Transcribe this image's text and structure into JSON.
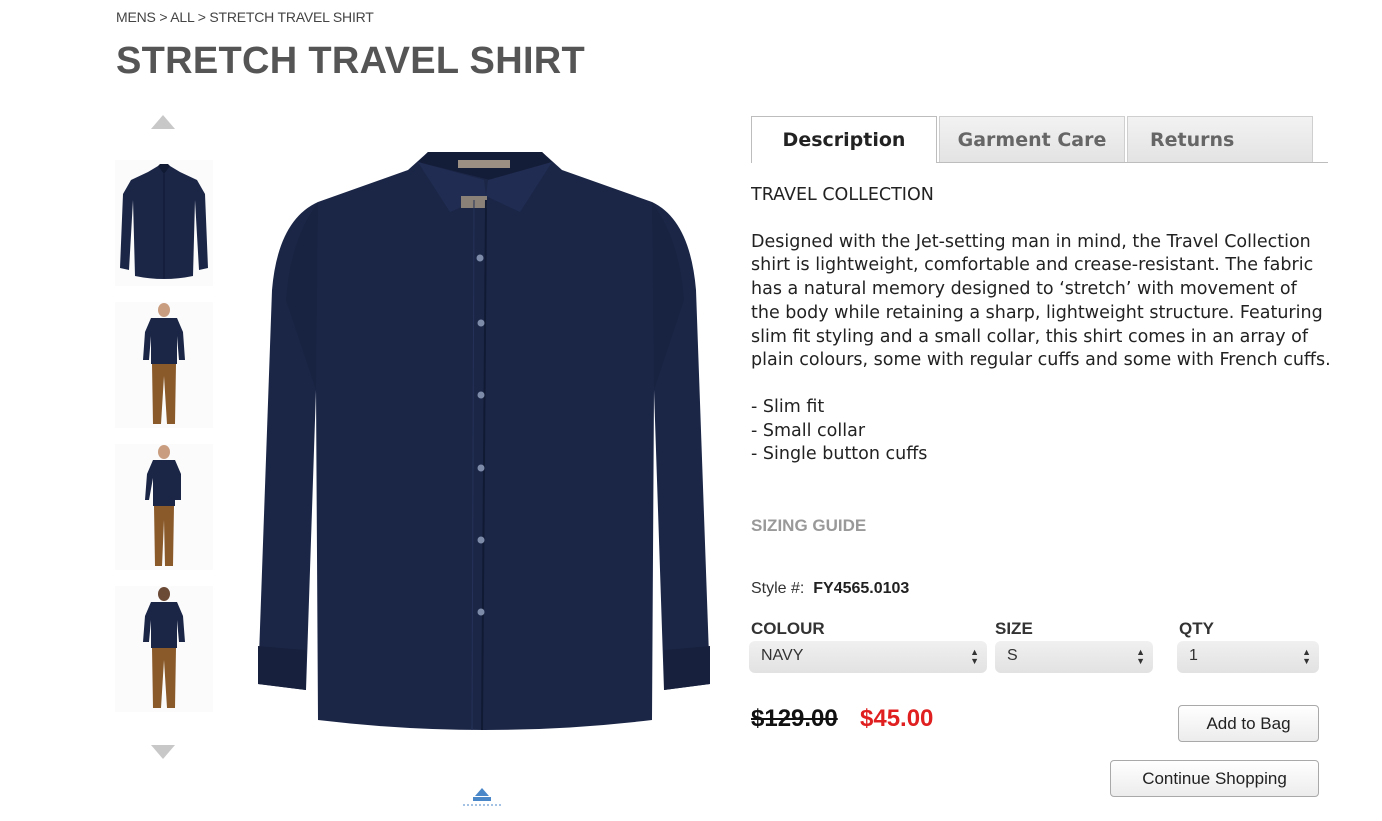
{
  "breadcrumb": "MENS > ALL > STRETCH TRAVEL SHIRT",
  "title": "STRETCH TRAVEL SHIRT",
  "tabs": [
    "Description",
    "Garment Care",
    "Returns"
  ],
  "description": {
    "heading": "TRAVEL COLLECTION",
    "body": "Designed with the Jet-setting man in mind, the Travel Collection shirt is lightweight, comfortable and crease-resistant. The fabric has a natural memory designed to ‘stretch’ with movement of the body while retaining a sharp, lightweight structure. Featuring slim fit styling and a small collar, this shirt comes in an array of plain colours, some with regular cuffs and some with French cuffs.",
    "features": [
      "- Slim fit",
      "- Small collar",
      "- Single button cuffs"
    ]
  },
  "sizing_guide": "SIZING GUIDE",
  "style": {
    "label": "Style #:",
    "value": "FY4565.0103"
  },
  "options": {
    "colour": {
      "label": "COLOUR",
      "value": "NAVY"
    },
    "size": {
      "label": "SIZE",
      "value": "S"
    },
    "qty": {
      "label": "QTY",
      "value": "1"
    }
  },
  "price": {
    "original": "$129.00",
    "sale": "$45.00"
  },
  "buttons": {
    "add_to_bag": "Add to Bag",
    "continue_shopping": "Continue Shopping"
  },
  "colors": {
    "shirt": "#1b2647",
    "trousers": "#8a5a2b",
    "sale_price": "#e02020"
  },
  "icons": {
    "thumb_up": "triangle-up-icon",
    "thumb_down": "triangle-down-icon",
    "zoom": "zoom-icon",
    "select": "select-arrows-icon"
  }
}
